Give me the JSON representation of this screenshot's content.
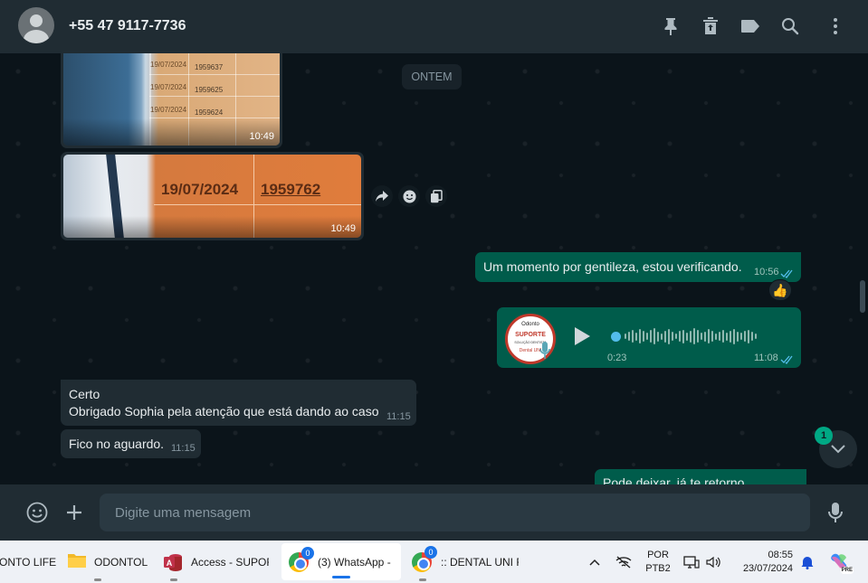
{
  "header": {
    "contact_name": "+55 47 9117-7736",
    "icons": [
      "pin-icon",
      "archive-icon",
      "label-icon",
      "search-icon",
      "menu-icon"
    ]
  },
  "chat": {
    "date_separator": "ONTEM",
    "image_messages": [
      {
        "time": "10:49",
        "photo_texts": [
          "19/07/2024",
          "1959637",
          "19/07/2024",
          "1959625",
          "19/07/2024",
          "1959624"
        ]
      },
      {
        "time": "10:49",
        "photo_texts": [
          "19/07/2024",
          "1959762"
        ]
      }
    ],
    "outgoing_text": {
      "text": "Um momento por gentileza, estou verificando.",
      "time": "10:56",
      "reaction": "👍"
    },
    "voice_message": {
      "duration": "0:23",
      "time": "11:08",
      "avatar_brand": "Odonto",
      "avatar_text_1": "SUPORTE",
      "avatar_text_2": "SOLUÇÃO DENTISTA",
      "avatar_text_3": "Dental UNI"
    },
    "incoming_messages": [
      {
        "line1": "Certo",
        "line2": "Obrigado Sophia pela atenção que está dando ao caso",
        "time": "11:15"
      },
      {
        "line1": "Fico no aguardo.",
        "time": "11:15"
      }
    ],
    "partial_outgoing": "Pode deixar, já te retorno",
    "unread_count": "1"
  },
  "input": {
    "placeholder": "Digite uma mensagem"
  },
  "taskbar": {
    "tasks": [
      {
        "label": "ONTO LIFE"
      },
      {
        "label": "ODONTOL"
      },
      {
        "label": "Access - SUPOR"
      },
      {
        "label": "(3) WhatsApp - ",
        "badge": "0"
      },
      {
        "label": ":: DENTAL UNI F",
        "badge": "0"
      }
    ],
    "language_top": "POR",
    "language_bottom": "PTB2",
    "clock_time": "08:55",
    "clock_date": "23/07/2024",
    "copilot_badge": "PRE"
  },
  "colors": {
    "accent": "#00a884",
    "outgoing_bubble": "#005c4b",
    "incoming_bubble": "#202c33",
    "header": "#202c33",
    "background": "#0b141a"
  }
}
